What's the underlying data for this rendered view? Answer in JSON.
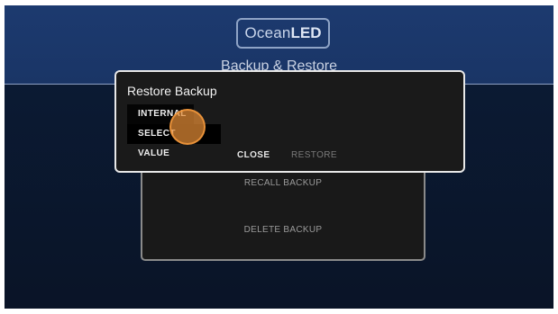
{
  "header": {
    "logo": {
      "ocean": "Ocean",
      "led": "LED"
    },
    "title": "Backup & Restore"
  },
  "panel": {
    "recall_label": "RECALL BACKUP",
    "delete_label": "DELETE BACKUP"
  },
  "dialog": {
    "title": "Restore Backup",
    "options": [
      "INTERNAL",
      "SELECT VALUE"
    ],
    "close_label": "CLOSE",
    "restore_label": "RESTORE"
  },
  "colors": {
    "header_bg": "#1c3a6f",
    "screen_bg": "#0a1426",
    "touch_indicator": "#e28a34"
  }
}
